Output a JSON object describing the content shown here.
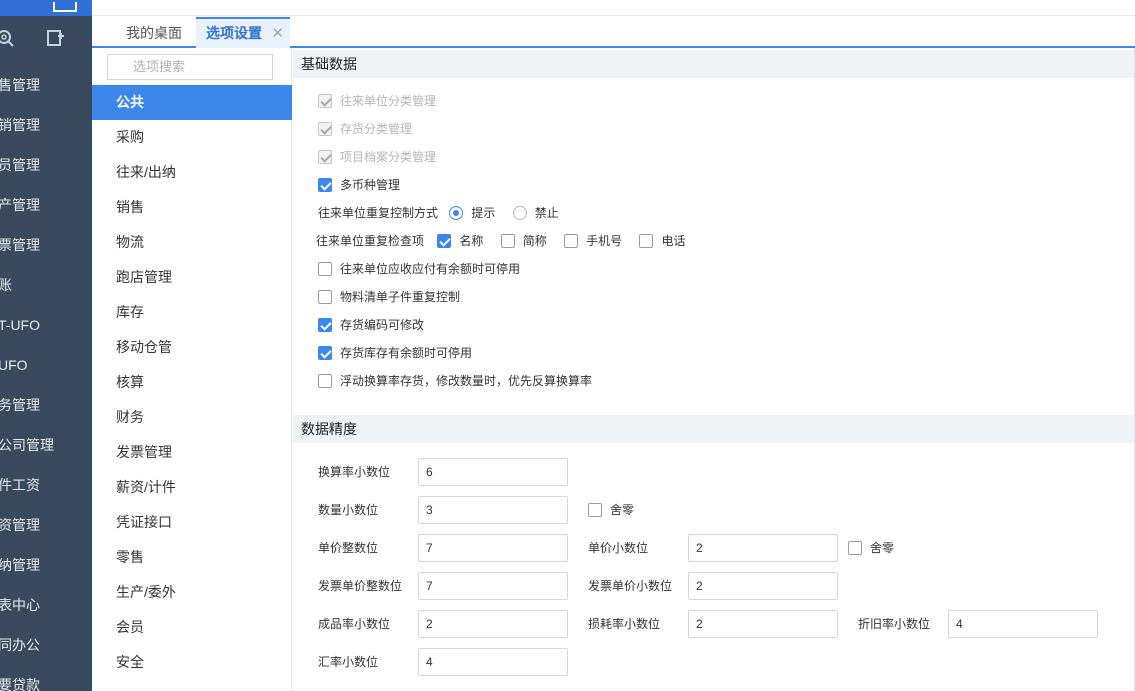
{
  "sidebar": {
    "brand_text": "",
    "items": [
      {
        "label": "售管理"
      },
      {
        "label": "销管理"
      },
      {
        "label": "员管理"
      },
      {
        "label": "产管理"
      },
      {
        "label": "票管理"
      },
      {
        "label": "账"
      },
      {
        "label": "T-UFO"
      },
      {
        "label": "UFO"
      },
      {
        "label": "务管理"
      },
      {
        "label": "公司管理"
      },
      {
        "label": "件工资"
      },
      {
        "label": "资管理"
      },
      {
        "label": "纳管理"
      },
      {
        "label": "表中心"
      },
      {
        "label": "同办公"
      },
      {
        "label": "要贷款"
      }
    ]
  },
  "tabs": {
    "desktop": "我的桌面",
    "options": "选项设置",
    "close": "✕"
  },
  "optnav": {
    "search_placeholder": "选项搜索",
    "items": [
      {
        "label": "公共"
      },
      {
        "label": "采购"
      },
      {
        "label": "往来/出纳"
      },
      {
        "label": "销售"
      },
      {
        "label": "物流"
      },
      {
        "label": "跑店管理"
      },
      {
        "label": "库存"
      },
      {
        "label": "移动仓管"
      },
      {
        "label": "核算"
      },
      {
        "label": "财务"
      },
      {
        "label": "发票管理"
      },
      {
        "label": "薪资/计件"
      },
      {
        "label": "凭证接口"
      },
      {
        "label": "零售"
      },
      {
        "label": "生产/委外"
      },
      {
        "label": "会员"
      },
      {
        "label": "安全"
      }
    ],
    "selected": "公共"
  },
  "basic": {
    "title": "基础数据",
    "opt1": "往来单位分类管理",
    "opt2": "存货分类管理",
    "opt3": "项目档案分类管理",
    "opt4": "多币种管理",
    "dup_ctrl_label": "往来单位重复控制方式",
    "dup_ctrl_prompt": "提示",
    "dup_ctrl_forbid": "禁止",
    "dup_check_label": "往来单位重复检查项",
    "dup_check_name": "名称",
    "dup_check_short": "简称",
    "dup_check_mobile": "手机号",
    "dup_check_phone": "电话",
    "opt5": "往来单位应收应付有余额时可停用",
    "opt6": "物料清单子件重复控制",
    "opt7": "存货编码可修改",
    "opt8": "存货库存有余额时可停用",
    "opt9": "浮动换算率存货，修改数量时，优先反算换算率"
  },
  "precision": {
    "title": "数据精度",
    "conv_rate_label": "换算率小数位",
    "conv_rate_value": "6",
    "qty_label": "数量小数位",
    "qty_value": "3",
    "qty_round": "舍零",
    "price_int_label": "单价整数位",
    "price_int_value": "7",
    "price_dec_label": "单价小数位",
    "price_dec_value": "2",
    "price_round": "舍零",
    "inv_price_int_label": "发票单价整数位",
    "inv_price_int_value": "7",
    "inv_price_dec_label": "发票单价小数位",
    "inv_price_dec_value": "2",
    "yield_label": "成品率小数位",
    "yield_value": "2",
    "loss_label": "损耗率小数位",
    "loss_value": "2",
    "depr_label": "折旧率小数位",
    "depr_value": "4",
    "fx_label": "汇率小数位",
    "fx_value": "4"
  },
  "colors": {
    "sidebar_bg": "#394a5e",
    "accent": "#3d86ea",
    "section_bg": "#f0f2f5"
  }
}
